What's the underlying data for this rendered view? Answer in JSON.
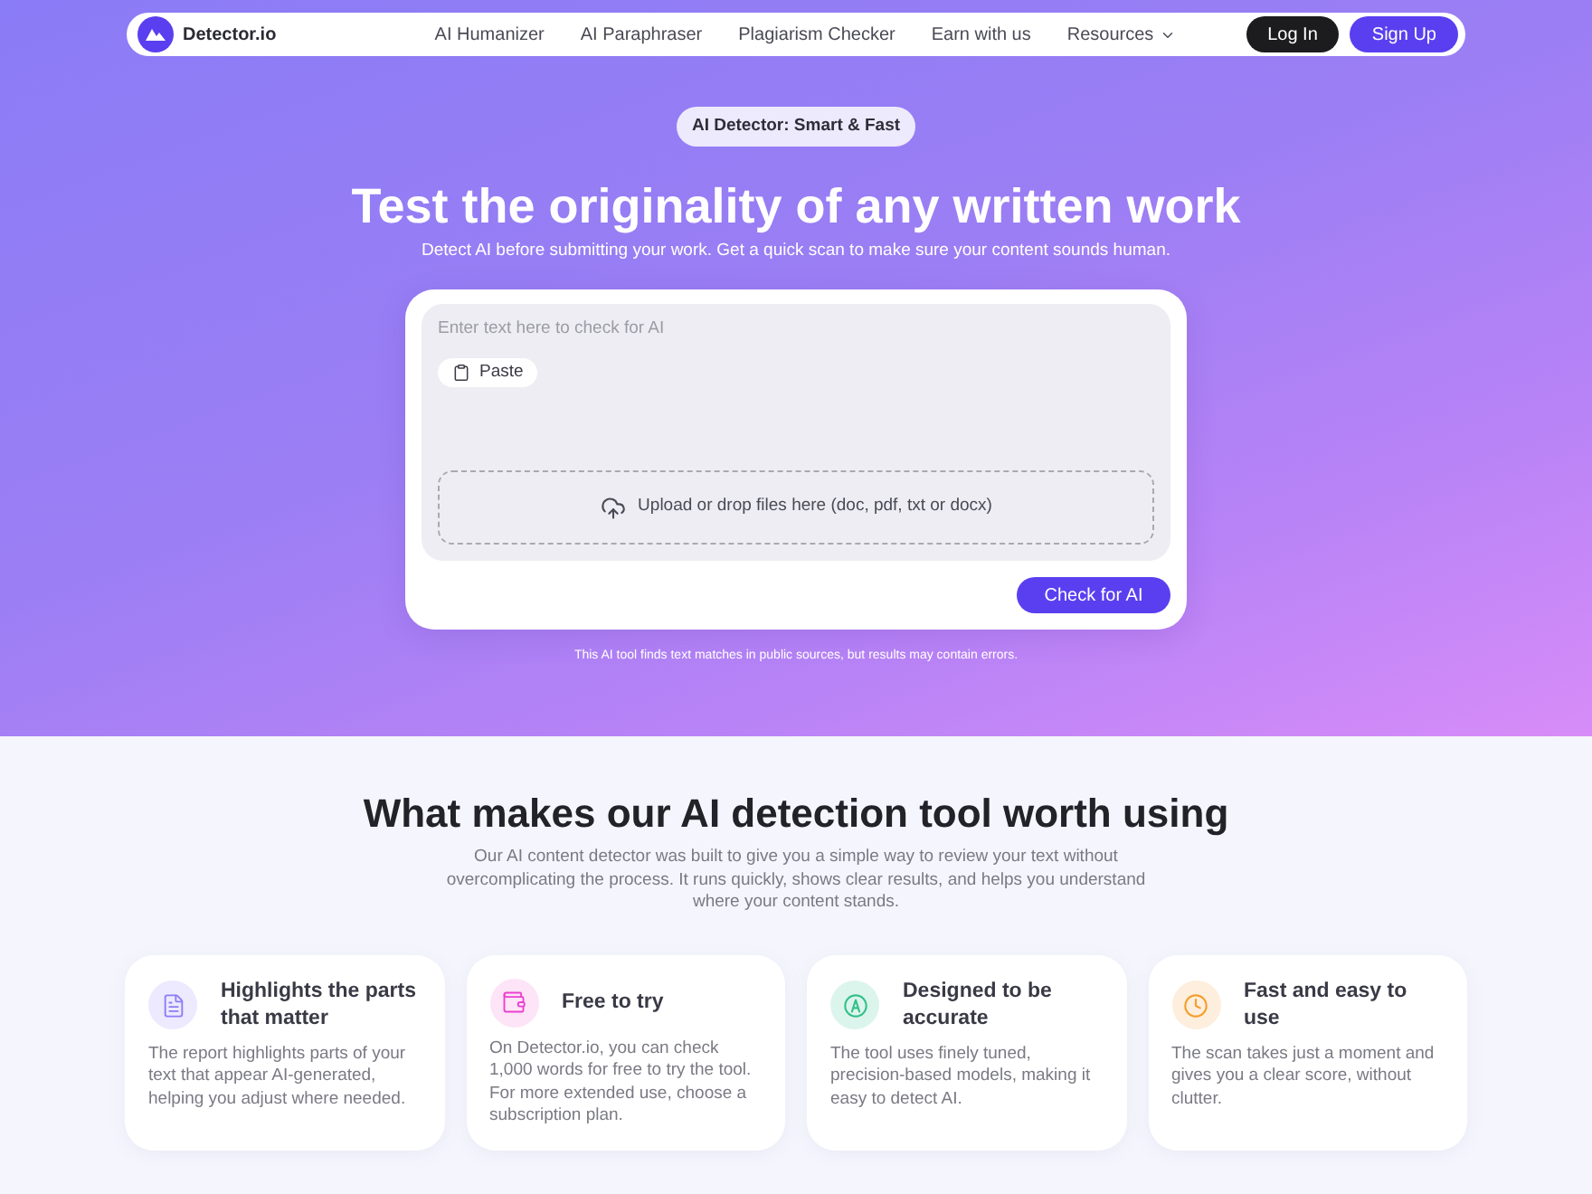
{
  "nav": {
    "logo": "Detector.io",
    "links": [
      {
        "label": "AI Humanizer",
        "dropdown": false
      },
      {
        "label": "AI Paraphraser",
        "dropdown": false
      },
      {
        "label": "Plagiarism Checker",
        "dropdown": false
      },
      {
        "label": "Earn with us",
        "dropdown": false
      },
      {
        "label": "Resources",
        "dropdown": true
      }
    ],
    "buttons": [
      {
        "label": "Log In",
        "kind": "dark"
      },
      {
        "label": "Sign Up",
        "kind": "primary"
      }
    ]
  },
  "hero": {
    "badge": "AI Detector: Smart & Fast",
    "title": "Test the originality of any written work",
    "subtitle": "Detect AI before submitting your work. Get a quick scan to make sure your content sounds human.",
    "editor": {
      "placeholder": "Enter text here to check for AI",
      "paste_button": "Paste",
      "upload_text": "Upload or drop files here (doc, pdf, txt or docx)",
      "submit_button": "Check for AI"
    },
    "disclaimer": "This AI tool finds text matches in public sources, but results may contain errors."
  },
  "features": {
    "title": "What makes our AI detection tool worth using",
    "description": "Our AI content detector was built to give you a simple way to review your text without overcomplicating the process. It runs quickly, shows clear results, and helps you understand where your content stands.",
    "cards": [
      {
        "kind": "highlight",
        "title": "Highlights the parts that matter",
        "text": "The report highlights parts of your text that appear AI-generated, helping you adjust where needed."
      },
      {
        "kind": "free",
        "title": "Free to try",
        "text": "On Detector.io, you can check 1,000 words for free to try the tool. For more extended use, choose a subscription plan."
      },
      {
        "kind": "accurate",
        "title": "Designed to be accurate",
        "text": "The tool uses finely tuned, precision-based models, making it easy to detect AI."
      },
      {
        "kind": "fast",
        "title": "Fast and easy to use",
        "text": "The scan takes just a moment and gives you a clear score, without clutter."
      }
    ]
  }
}
